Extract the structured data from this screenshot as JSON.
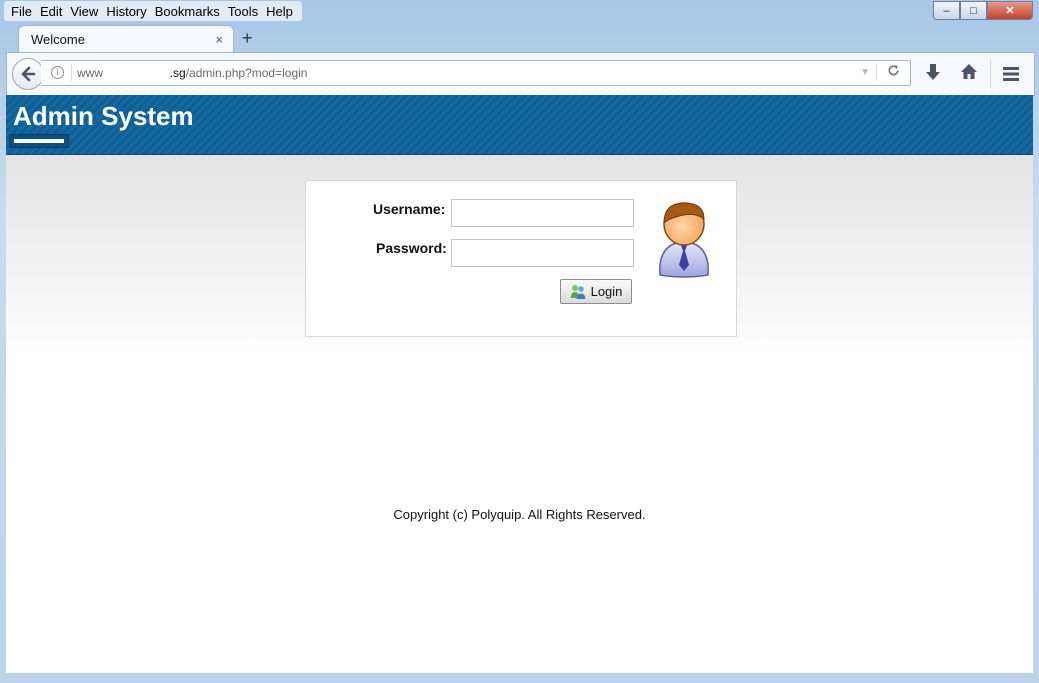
{
  "browser": {
    "menu": [
      "File",
      "Edit",
      "View",
      "History",
      "Bookmarks",
      "Tools",
      "Help"
    ],
    "tab_title": "Welcome",
    "tab_close": "×",
    "new_tab": "+",
    "window_controls": {
      "minimize": "–",
      "maximize": "□",
      "close": "✕"
    },
    "url_prefix": "www",
    "url_domain": ".sg",
    "url_path": "/admin.php?mod=login",
    "icons": [
      "back-arrow-icon",
      "info-icon",
      "dropdown-icon",
      "reload-icon",
      "download-icon",
      "home-icon",
      "hamburger-menu-icon"
    ]
  },
  "site": {
    "title": "Admin System",
    "header_color": "#0e5f93"
  },
  "login": {
    "username_label": "Username:",
    "password_label": "Password:",
    "username_value": "",
    "password_value": "",
    "button_label": "Login"
  },
  "footer": {
    "copyright": "Copyright (c) Polyquip. All Rights Reserved."
  }
}
